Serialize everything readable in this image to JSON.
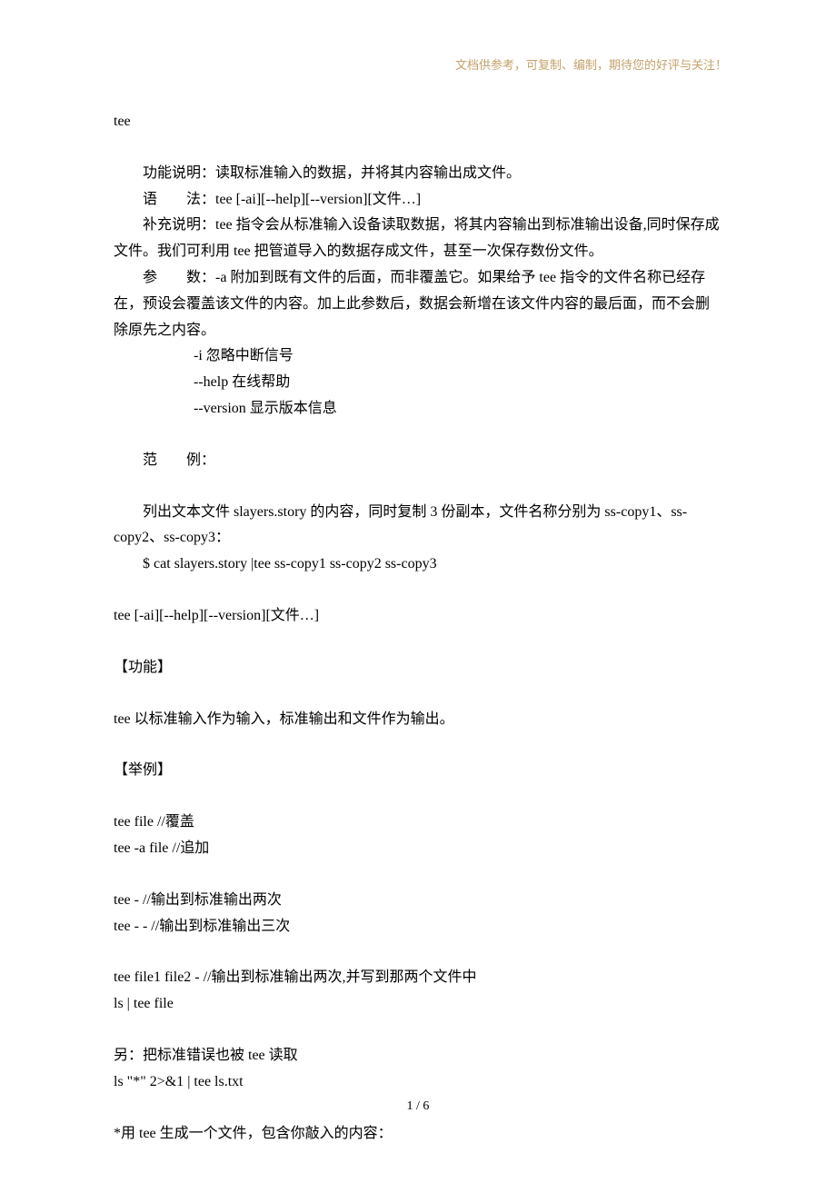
{
  "header": {
    "text": "文档供参考，可复制、编制，期待您的好评与关注！"
  },
  "lines": {
    "l0": "tee",
    "l1": "功能说明：读取标准输入的数据，并将其内容输出成文件。",
    "l2": "语　　法：tee [-ai][--help][--version][文件…]",
    "l3": "补充说明：tee 指令会从标准输入设备读取数据，将其内容输出到标准输出设备,同时保存成文件。我们可利用 tee 把管道导入的数据存成文件，甚至一次保存数份文件。",
    "l4": "参　　数：-a 附加到既有文件的后面，而非覆盖它。如果给予 tee 指令的文件名称已经存在，预设会覆盖该文件的内容。加上此参数后，数据会新增在该文件内容的最后面，而不会删除原先之内容。",
    "l5": "-i  忽略中断信号",
    "l6": "--help  在线帮助",
    "l7": "--version  显示版本信息",
    "l8": "范　　例：",
    "l9": "列出文本文件 slayers.story 的内容，同时复制 3 份副本，文件名称分别为 ss-copy1、ss-copy2、ss-copy3：",
    "l10": "$ cat slayers.story |tee ss-copy1 ss-copy2 ss-copy3",
    "l11": "tee [-ai][--help][--version][文件…]",
    "l12": "【功能】",
    "l13": "tee 以标准输入作为输入，标准输出和文件作为输出。",
    "l14": "【举例】",
    "l15": "tee file        //覆盖",
    "l16": "tee -a file       //追加",
    "l17": "tee -             //输出到标准输出两次",
    "l18": "tee - -      //输出到标准输出三次",
    "l19": "tee file1 file2 -       //输出到标准输出两次,并写到那两个文件中",
    "l20": "ls | tee file",
    "l21": "另：把标准错误也被 tee 读取",
    "l22": "ls \"*\" 2>&1 | tee ls.txt",
    "l23": "*用 tee 生成一个文件，包含你敲入的内容："
  },
  "footer": {
    "page": "1 / 6"
  }
}
